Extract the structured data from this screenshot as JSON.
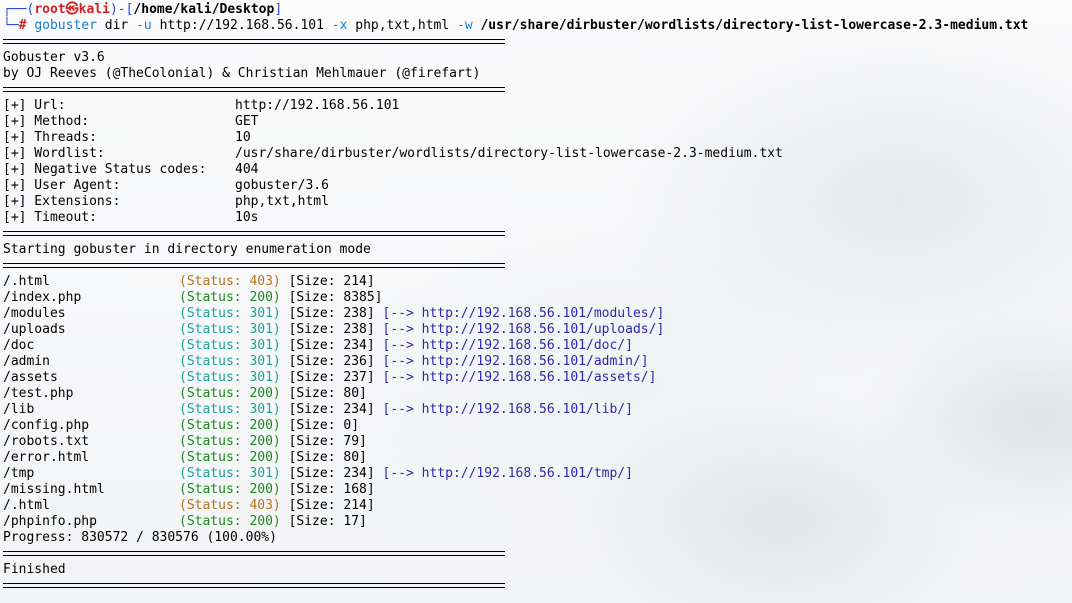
{
  "prompt": {
    "open": "┌──(",
    "user": "root㉿kali",
    "mid": ")-[",
    "path": "/home/kali/Desktop",
    "close": "]",
    "second": "└─",
    "hash": "#"
  },
  "command": {
    "tool": "gobuster",
    "sub": "dir",
    "flag_u": "-u",
    "url": "http://192.168.56.101",
    "flag_x": "-x",
    "ext": "php,txt,html",
    "flag_w": "-w",
    "wordlist": "/usr/share/dirbuster/wordlists/directory-list-lowercase-2.3-medium.txt"
  },
  "banner": {
    "version": "Gobuster v3.6",
    "authors": "by OJ Reeves (@TheColonial) & Christian Mehlmauer (@firefart)"
  },
  "config": [
    {
      "key": "[+] Url:",
      "value": "http://192.168.56.101"
    },
    {
      "key": "[+] Method:",
      "value": "GET"
    },
    {
      "key": "[+] Threads:",
      "value": "10"
    },
    {
      "key": "[+] Wordlist:",
      "value": "/usr/share/dirbuster/wordlists/directory-list-lowercase-2.3-medium.txt"
    },
    {
      "key": "[+] Negative Status codes:",
      "value": "404"
    },
    {
      "key": "[+] User Agent:",
      "value": "gobuster/3.6"
    },
    {
      "key": "[+] Extensions:",
      "value": "php,txt,html"
    },
    {
      "key": "[+] Timeout:",
      "value": "10s"
    }
  ],
  "start_msg": "Starting gobuster in directory enumeration mode",
  "results": [
    {
      "path": "/.html",
      "status": "(Status: 403)",
      "code": 403,
      "size": "[Size: 214]",
      "redirect": ""
    },
    {
      "path": "/index.php",
      "status": "(Status: 200)",
      "code": 200,
      "size": "[Size: 8385]",
      "redirect": ""
    },
    {
      "path": "/modules",
      "status": "(Status: 301)",
      "code": 301,
      "size": "[Size: 238]",
      "redirect": "http://192.168.56.101/modules/"
    },
    {
      "path": "/uploads",
      "status": "(Status: 301)",
      "code": 301,
      "size": "[Size: 238]",
      "redirect": "http://192.168.56.101/uploads/"
    },
    {
      "path": "/doc",
      "status": "(Status: 301)",
      "code": 301,
      "size": "[Size: 234]",
      "redirect": "http://192.168.56.101/doc/"
    },
    {
      "path": "/admin",
      "status": "(Status: 301)",
      "code": 301,
      "size": "[Size: 236]",
      "redirect": "http://192.168.56.101/admin/"
    },
    {
      "path": "/assets",
      "status": "(Status: 301)",
      "code": 301,
      "size": "[Size: 237]",
      "redirect": "http://192.168.56.101/assets/"
    },
    {
      "path": "/test.php",
      "status": "(Status: 200)",
      "code": 200,
      "size": "[Size: 80]",
      "redirect": ""
    },
    {
      "path": "/lib",
      "status": "(Status: 301)",
      "code": 301,
      "size": "[Size: 234]",
      "redirect": "http://192.168.56.101/lib/"
    },
    {
      "path": "/config.php",
      "status": "(Status: 200)",
      "code": 200,
      "size": "[Size: 0]",
      "redirect": ""
    },
    {
      "path": "/robots.txt",
      "status": "(Status: 200)",
      "code": 200,
      "size": "[Size: 79]",
      "redirect": ""
    },
    {
      "path": "/error.html",
      "status": "(Status: 200)",
      "code": 200,
      "size": "[Size: 80]",
      "redirect": ""
    },
    {
      "path": "/tmp",
      "status": "(Status: 301)",
      "code": 301,
      "size": "[Size: 234]",
      "redirect": "http://192.168.56.101/tmp/"
    },
    {
      "path": "/missing.html",
      "status": "(Status: 200)",
      "code": 200,
      "size": "[Size: 168]",
      "redirect": ""
    },
    {
      "path": "/.html",
      "status": "(Status: 403)",
      "code": 403,
      "size": "[Size: 214]",
      "redirect": ""
    },
    {
      "path": "/phpinfo.php",
      "status": "(Status: 200)",
      "code": 200,
      "size": "[Size: 17]",
      "redirect": ""
    }
  ],
  "redirect_arrow": "[-->",
  "redirect_close": "]",
  "progress": "Progress: 830572 / 830576 (100.00%)",
  "finished": "Finished",
  "colors": {
    "status_200": "#1a8a1a",
    "status_301": "#1aa39c",
    "status_403": "#b5721b",
    "link": "#2a2aa8"
  }
}
